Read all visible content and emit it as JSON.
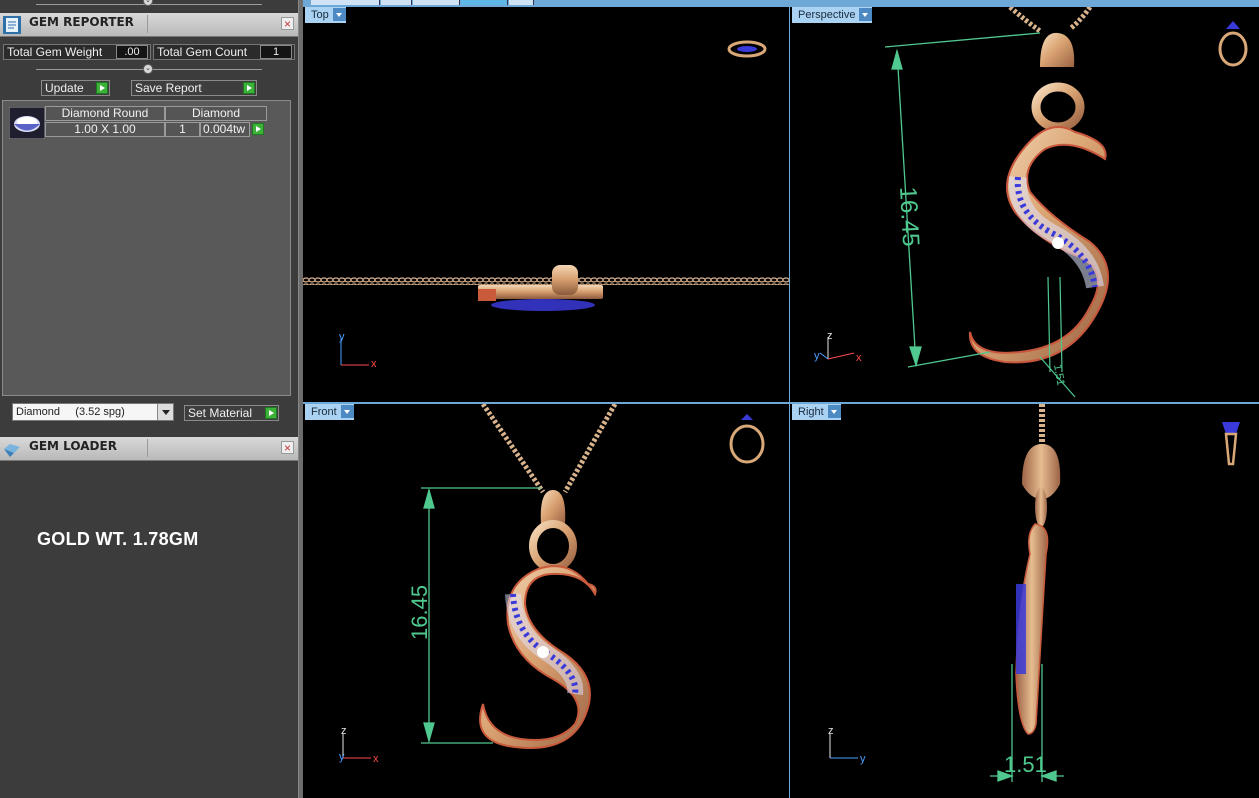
{
  "gem_reporter": {
    "title": "GEM REPORTER",
    "total_weight_label": "Total Gem Weight",
    "total_weight_value": ".00",
    "total_count_label": "Total Gem Count",
    "total_count_value": "1",
    "update_label": "Update",
    "save_report_label": "Save Report",
    "gems": [
      {
        "shape": "Diamond Round",
        "material": "Diamond",
        "size": "1.00 X 1.00",
        "count": "1",
        "weight": "0.004tw"
      }
    ],
    "material_select_value": "Diamond     (3.52 spg)",
    "set_material_label": "Set Material"
  },
  "gem_loader": {
    "title": "GEM LOADER"
  },
  "annotation": {
    "gold_weight": "GOLD WT. 1.78GM"
  },
  "viewports": {
    "top": {
      "label": "Top"
    },
    "perspective": {
      "label": "Perspective",
      "dimension_height": "16.45",
      "dimension_thickness": "1.51"
    },
    "front": {
      "label": "Front",
      "dimension_height": "16.45"
    },
    "right": {
      "label": "Right",
      "dimension_thickness": "1.51"
    }
  },
  "colors": {
    "gold": "#d9a878",
    "dimension": "#4fc98f",
    "viewport_tag": "#a9d2f3",
    "gem_blue": "#3a3adb"
  }
}
